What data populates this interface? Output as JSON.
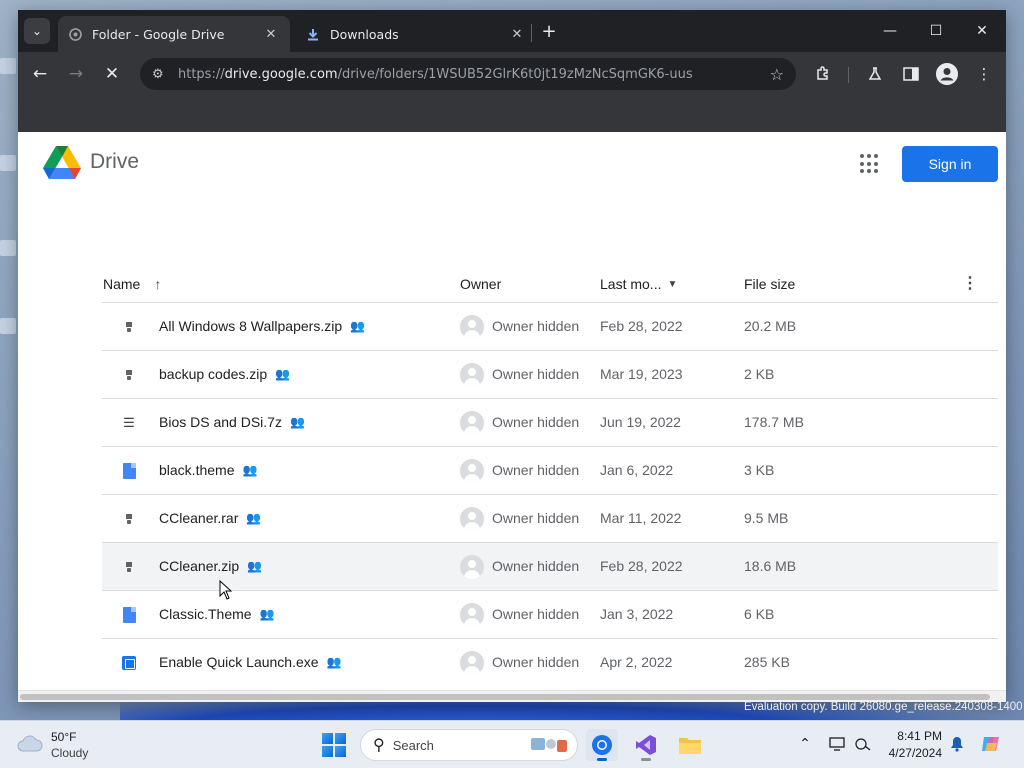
{
  "browser": {
    "tabs": [
      {
        "title": "Folder - Google Drive",
        "active": true
      },
      {
        "title": "Downloads",
        "active": false
      }
    ],
    "url_domain": "drive.google.com",
    "url_prefix": "https://",
    "url_path": "/drive/folders/1WSUB52GlrK6t0jt19zMzNcSqmGK6-uus"
  },
  "page": {
    "app_name": "Drive",
    "signin_label": "Sign in",
    "columns": {
      "name": "Name",
      "owner": "Owner",
      "modified": "Last mo...",
      "size": "File size"
    },
    "files": [
      {
        "name": "All Windows 8 Wallpapers.zip",
        "type": "zip",
        "owner": "Owner hidden",
        "date": "Feb 28, 2022",
        "size": "20.2 MB"
      },
      {
        "name": "backup codes.zip",
        "type": "zip",
        "owner": "Owner hidden",
        "date": "Mar 19, 2023",
        "size": "2 KB"
      },
      {
        "name": "Bios DS and DSi.7z",
        "type": "list",
        "owner": "Owner hidden",
        "date": "Jun 19, 2022",
        "size": "178.7 MB"
      },
      {
        "name": "black.theme",
        "type": "doc",
        "owner": "Owner hidden",
        "date": "Jan 6, 2022",
        "size": "3 KB"
      },
      {
        "name": "CCleaner.rar",
        "type": "zip",
        "owner": "Owner hidden",
        "date": "Mar 11, 2022",
        "size": "9.5 MB"
      },
      {
        "name": "CCleaner.zip",
        "type": "zip",
        "owner": "Owner hidden",
        "date": "Feb 28, 2022",
        "size": "18.6 MB"
      },
      {
        "name": "Classic.Theme",
        "type": "doc",
        "owner": "Owner hidden",
        "date": "Jan 3, 2022",
        "size": "6 KB"
      },
      {
        "name": "Enable Quick Launch.exe",
        "type": "exe",
        "owner": "Owner hidden",
        "date": "Apr 2, 2022",
        "size": "285 KB"
      }
    ]
  },
  "desktop": {
    "watermark": "Evaluation copy. Build 26080.ge_release.240308-1400"
  },
  "taskbar": {
    "weather_temp": "50°F",
    "weather_desc": "Cloudy",
    "search_placeholder": "Search",
    "time": "8:41 PM",
    "date": "4/27/2024"
  }
}
